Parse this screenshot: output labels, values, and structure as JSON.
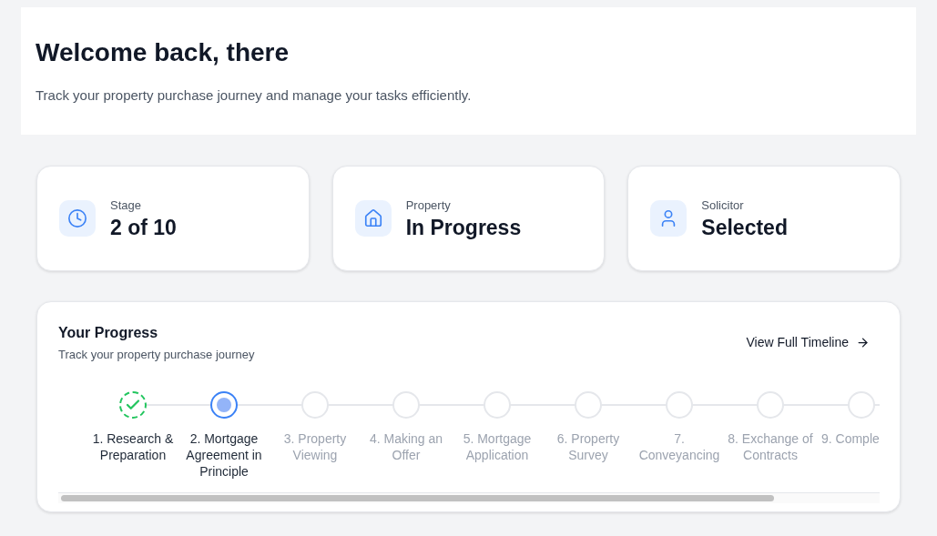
{
  "header": {
    "title": "Welcome back, there",
    "subtitle": "Track your property purchase journey and manage your tasks efficiently."
  },
  "stats": [
    {
      "kind": "clock",
      "label": "Stage",
      "value": "2 of 10"
    },
    {
      "kind": "house",
      "label": "Property",
      "value": "In Progress"
    },
    {
      "kind": "person",
      "label": "Solicitor",
      "value": "Selected"
    }
  ],
  "progress": {
    "title": "Your Progress",
    "subtitle": "Track your property purchase journey",
    "link": "View Full Timeline",
    "steps": [
      {
        "label": "1. Research & Preparation",
        "kind": "done"
      },
      {
        "label": "2. Mortgage Agreement in Principle",
        "kind": "current"
      },
      {
        "label": "3. Property Viewing",
        "kind": "pending"
      },
      {
        "label": "4. Making an Offer",
        "kind": "pending"
      },
      {
        "label": "5. Mortgage Application",
        "kind": "pending"
      },
      {
        "label": "6. Property Survey",
        "kind": "pending"
      },
      {
        "label": "7. Conveyancing",
        "kind": "pending"
      },
      {
        "label": "8. Exchange of Contracts",
        "kind": "pending"
      },
      {
        "label": "9. Comple",
        "kind": "pending"
      }
    ]
  }
}
